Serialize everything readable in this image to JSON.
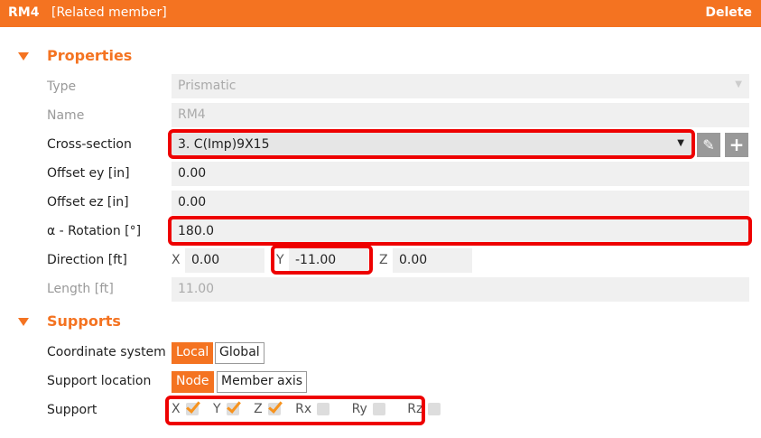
{
  "header": {
    "id": "RM4",
    "subtitle": "[Related member]",
    "delete": "Delete"
  },
  "properties": {
    "title": "Properties",
    "type": {
      "label": "Type",
      "value": "Prismatic"
    },
    "name": {
      "label": "Name",
      "value": "RM4"
    },
    "cross_section": {
      "label": "Cross-section",
      "value": "3. C(Imp)9X15"
    },
    "offset_ey": {
      "label": "Offset ey [in]",
      "value": "0.00"
    },
    "offset_ez": {
      "label": "Offset ez [in]",
      "value": "0.00"
    },
    "rotation": {
      "label": "α - Rotation [°]",
      "value": "180.0"
    },
    "direction": {
      "label": "Direction [ft]",
      "x_label": "X",
      "x": "0.00",
      "y_label": "Y",
      "y": "-11.00",
      "z_label": "Z",
      "z": "0.00"
    },
    "length": {
      "label": "Length [ft]",
      "value": "11.00"
    }
  },
  "supports": {
    "title": "Supports",
    "coordinate_system": {
      "label": "Coordinate system",
      "options": [
        "Local",
        "Global"
      ],
      "selected": "Local"
    },
    "support_location": {
      "label": "Support location",
      "options": [
        "Node",
        "Member axis"
      ],
      "selected": "Node"
    },
    "support": {
      "label": "Support",
      "items": [
        {
          "label": "X",
          "checked": true
        },
        {
          "label": "Y",
          "checked": true
        },
        {
          "label": "Z",
          "checked": true
        },
        {
          "label": "Rx",
          "checked": false
        },
        {
          "label": "Ry",
          "checked": false
        },
        {
          "label": "Rz",
          "checked": false
        }
      ]
    }
  }
}
